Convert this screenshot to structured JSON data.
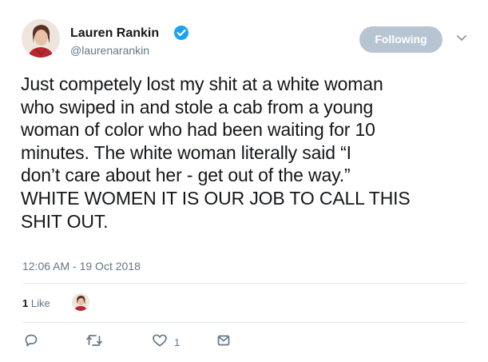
{
  "user": {
    "name": "Lauren Rankin",
    "handle": "@laurenarankin",
    "verified": true
  },
  "follow_button": {
    "label": "Following"
  },
  "tweet": {
    "text": "Just competely lost my shit at a white woman\nwho swiped in and stole a cab from a young\nwoman of color who had been waiting for 10\nminutes. The white woman literally said “I\ndon’t care about her - get out of the way.”\nWHITE WOMEN IT IS OUR JOB TO CALL THIS\nSHIT OUT.",
    "timestamp": "12:06 AM - 19 Oct 2018"
  },
  "stats": {
    "likes_count": "1",
    "likes_label": "Like"
  },
  "actions": {
    "like_count": "1"
  },
  "icons": [
    "verified-badge-icon",
    "chevron-down-icon",
    "reply-icon",
    "retweet-icon",
    "like-icon",
    "direct-message-icon"
  ],
  "colors": {
    "accent": "#1da1f2",
    "following_button": "#b7c5d2",
    "secondary_text": "#657786"
  }
}
